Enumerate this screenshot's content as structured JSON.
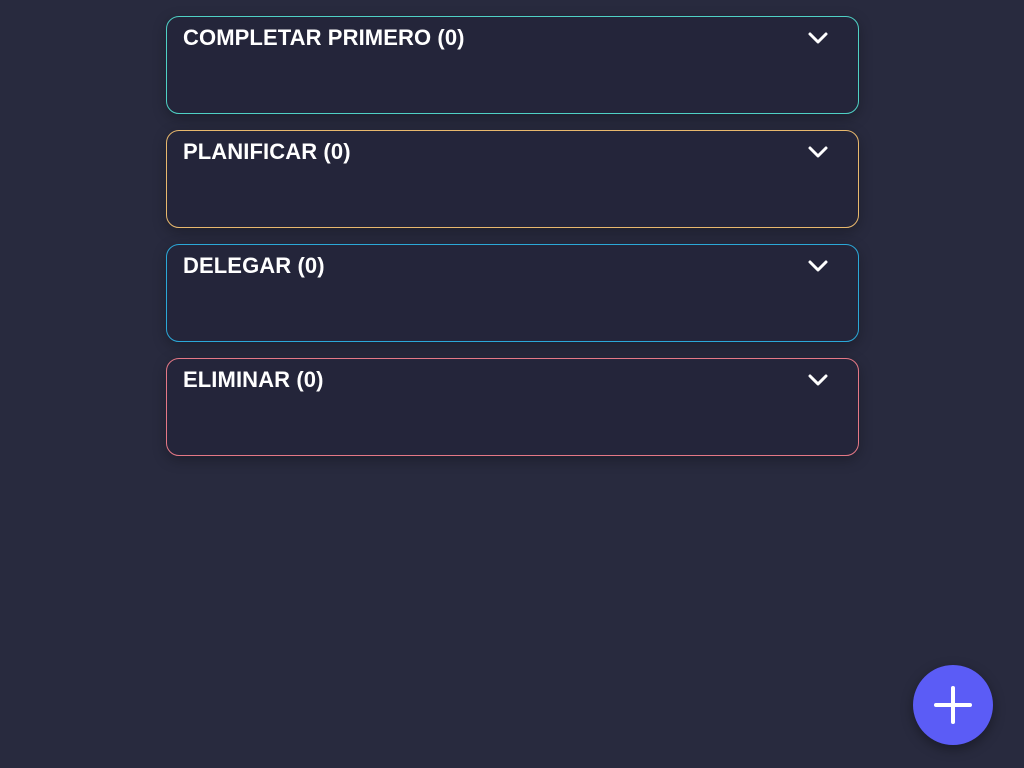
{
  "sections": [
    {
      "title": "COMPLETAR PRIMERO (0)",
      "border_color": "#4fd1c5",
      "icon": "chevron-down-icon"
    },
    {
      "title": "PLANIFICAR (0)",
      "border_color": "#e8b86d",
      "icon": "chevron-down-icon"
    },
    {
      "title": "DELEGAR (0)",
      "border_color": "#2ba8d8",
      "icon": "chevron-down-icon"
    },
    {
      "title": "ELIMINAR (0)",
      "border_color": "#e57886",
      "icon": "chevron-down-icon"
    }
  ],
  "fab": {
    "icon": "plus-icon",
    "color": "#5b5cf6"
  }
}
